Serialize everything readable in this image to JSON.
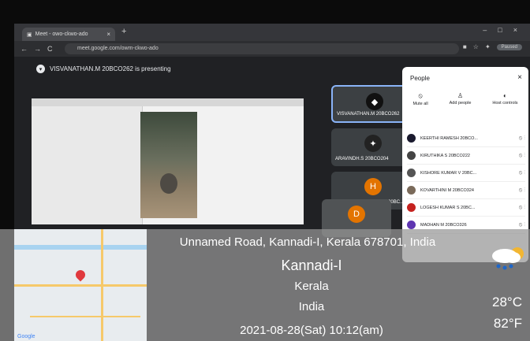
{
  "browser": {
    "tab_title": "Meet - owo-ckwo-ado",
    "url": "meet.google.com/owm-ckwo-ado",
    "paused_label": "Paused"
  },
  "meet": {
    "presenting_text": "VISVANATHAN.M 20BCO262 is presenting",
    "tiles": [
      {
        "name": "VISVANATHAN.M 20BCO262",
        "color": "#111111"
      },
      {
        "name": "ARAVINDH.S 20BCO204",
        "color": "#222222"
      },
      {
        "name": "HARIPRABHAKARAN V 20BC...",
        "initial": "H",
        "color": "#e37400"
      },
      {
        "initial": "D",
        "color": "#e37400"
      }
    ],
    "people": {
      "title": "People",
      "actions": [
        "Mute all",
        "Add people",
        "Host controls"
      ],
      "list": [
        {
          "name": "KEERTHI RAMESH 20BCO...",
          "color": "#1a1a2e"
        },
        {
          "name": "KIRUTHIKA S 20BCO222",
          "color": "#444444"
        },
        {
          "name": "KISHORE KUMAR V 20BC...",
          "color": "#555555"
        },
        {
          "name": "KOVARTHINI M 20BCO324",
          "color": "#7a6a5a"
        },
        {
          "name": "LOGESH KUMAR S 20BC...",
          "color": "#c5221f"
        },
        {
          "name": "MADHAN M 20BCO326",
          "color": "#5e35b1"
        }
      ]
    }
  },
  "overlay": {
    "address": "Unnamed Road, Kannadi-I, Kerala 678701, India",
    "city": "Kannadi-I",
    "state": "Kerala",
    "country": "India",
    "datetime": "2021-08-28(Sat)   10:12(am)",
    "temp_c": "28°C",
    "temp_f": "82°F",
    "map_logo": "Google"
  }
}
